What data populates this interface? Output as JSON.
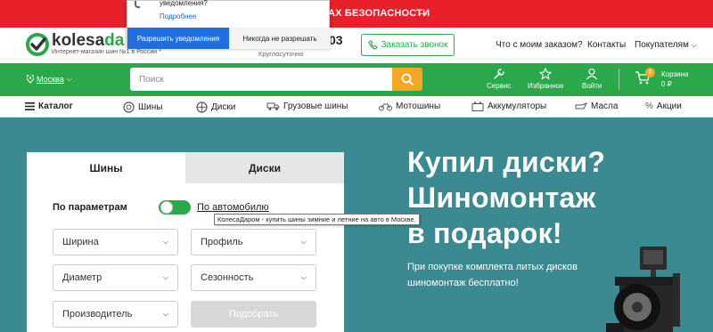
{
  "promo": {
    "text": "АХ БЕЗОПАСНОСТИ",
    "arrow": "→"
  },
  "header": {
    "logo_text_dark": "kolesa",
    "logo_text_green": "da",
    "tagline": "Интернет-магазин шин №1 в России *",
    "phone_tail": "03",
    "hours": "Круглосуточно",
    "callback_label": "Заказать звонок",
    "links": {
      "order_status": "Что с моим заказом?",
      "contacts": "Контакты",
      "buyers": "Покупателям"
    }
  },
  "greenbar": {
    "city": "Москва",
    "search_placeholder": "Поиск",
    "service": "Сервис",
    "favorites": "Избранное",
    "login": "Войти",
    "cart_label": "Корзина",
    "cart_sum": "0 ₽",
    "cart_count": "0"
  },
  "catnav": {
    "catalog": "Каталог",
    "items": [
      "Шины",
      "Диски",
      "Грузовые шины",
      "Мотошины",
      "Аккумуляторы",
      "Масла",
      "Акции"
    ]
  },
  "hero": {
    "title_line1": "Купил диски?",
    "title_line2": "Шиномонтаж",
    "title_line3": "в подарок!",
    "subtitle_line1": "При покупке комплекта литых дисков",
    "subtitle_line2": "шиномонтаж бесплатно!"
  },
  "filter": {
    "tab_tires": "Шины",
    "tab_discs": "Диски",
    "mode_params": "По параметрам",
    "mode_auto": "По автомобилю",
    "width": "Ширина",
    "profile": "Профиль",
    "diameter": "Диаметр",
    "season": "Сезонность",
    "manufacturer": "Производитель",
    "submit": "Подобрать"
  },
  "notification": {
    "text": "уведомления?",
    "more": "Подробнее",
    "allow": "Разрешить уведомления",
    "deny": "Никогда не разрешать"
  },
  "tooltip": "КолесаДаром - купить шины зимние и летние на авто в Москве.",
  "colors": {
    "red": "#e8202a",
    "green": "#2ba84a",
    "orange": "#f5a623",
    "teal": "#3b8a92"
  }
}
